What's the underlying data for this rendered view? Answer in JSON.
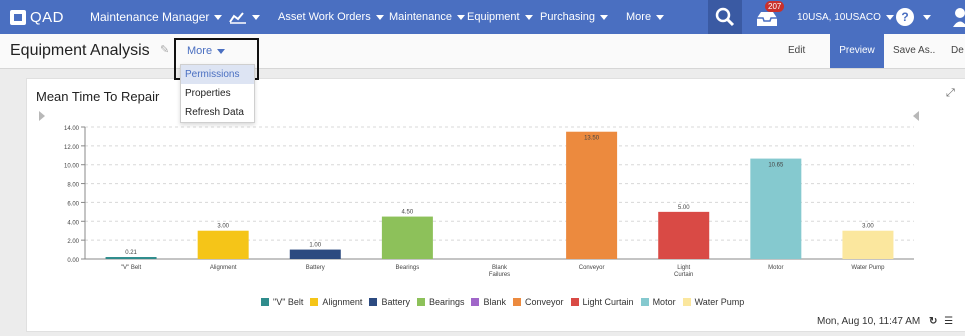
{
  "topbar": {
    "logo_text": "QAD",
    "menus": [
      {
        "label": "Maintenance Manager"
      },
      {
        "label": "Asset Work Orders"
      },
      {
        "label": "Maintenance"
      },
      {
        "label": "Equipment"
      },
      {
        "label": "Purchasing"
      },
      {
        "label": "More"
      }
    ],
    "notification_count": "207",
    "user_label": "10USA, 10USACO",
    "help_label": "?"
  },
  "subbar": {
    "page_title": "Equipment Analysis",
    "more_label": "More",
    "actions": [
      "Edit",
      "Preview",
      "Save As..",
      "De"
    ]
  },
  "dropdown": {
    "items": [
      "Permissions",
      "Properties",
      "Refresh Data"
    ],
    "selected": "Permissions"
  },
  "card": {
    "title": "Mean Time To Repair",
    "timestamp": "Mon, Aug 10, 11:47 AM"
  },
  "chart_data": {
    "type": "bar",
    "title": "Mean Time To Repair",
    "categories": [
      "\"V\" Belt",
      "Alignment",
      "Battery",
      "Bearings",
      "Blank Failures",
      "Conveyor",
      "Light Curtain",
      "Motor",
      "Water Pump"
    ],
    "values": [
      0.21,
      3.0,
      1.0,
      4.5,
      null,
      13.5,
      5.0,
      10.65,
      3.0
    ],
    "value_labels": [
      "0.21",
      "3.00",
      "1.00",
      "4.50",
      "",
      "13.50",
      "5.00",
      "10.65",
      "3.00"
    ],
    "colors": [
      "#2f8c8c",
      "#f5c518",
      "#2c4a80",
      "#8dc15a",
      "#a066c9",
      "#ec8a3e",
      "#d94a45",
      "#85c9cf",
      "#fbe79e"
    ],
    "yticks": [
      "14.00",
      "12.00",
      "10.00",
      "8.00",
      "6.00",
      "4.00",
      "2.00",
      "0.00"
    ],
    "ylim": [
      0,
      14
    ],
    "legend": [
      "\"V\" Belt",
      "Alignment",
      "Battery",
      "Bearings",
      "Blank",
      "Conveyor",
      "Light Curtain",
      "Motor",
      "Water Pump"
    ],
    "legend_position": "bottom",
    "grid": true
  }
}
